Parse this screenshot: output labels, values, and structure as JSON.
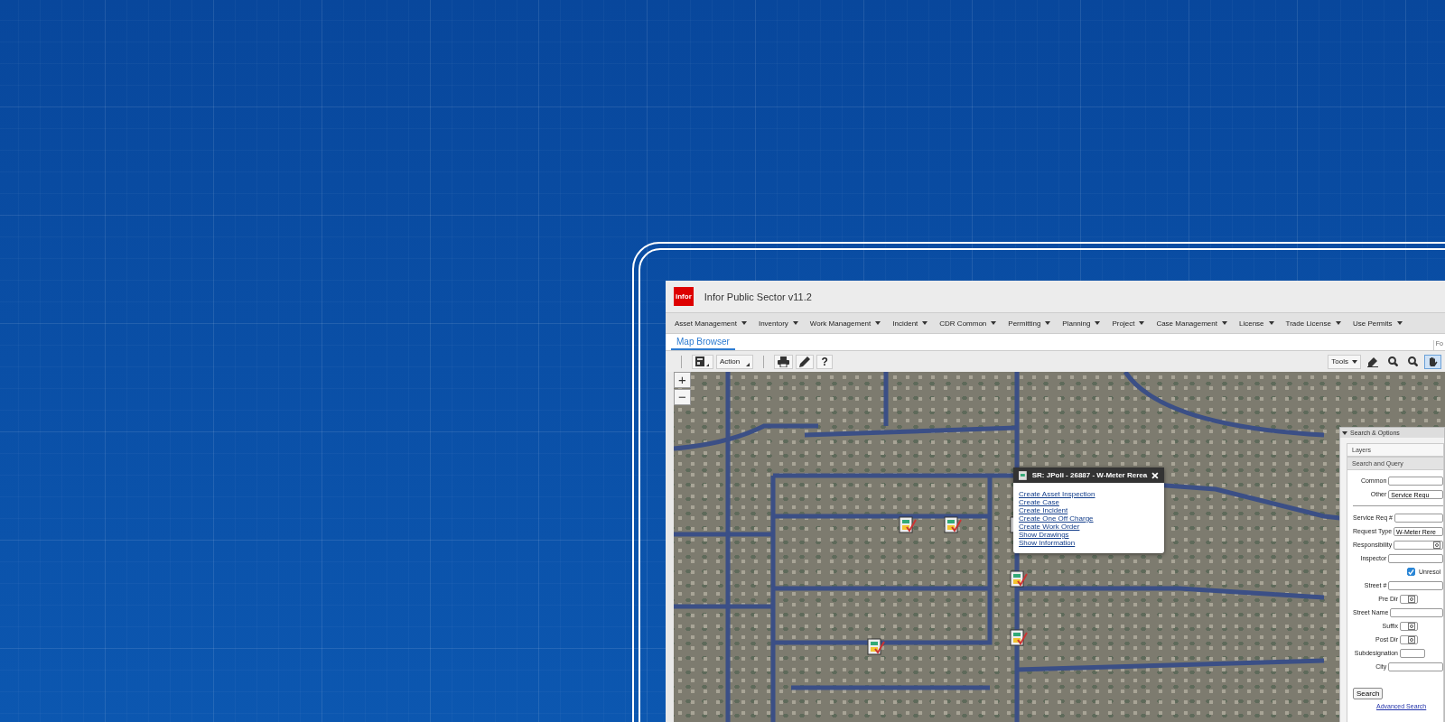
{
  "window": {
    "title": "Infor Public Sector v11.2",
    "logo": "infor"
  },
  "menu": [
    {
      "label": "Asset Management"
    },
    {
      "label": "Inventory"
    },
    {
      "label": "Work Management"
    },
    {
      "label": "Incident"
    },
    {
      "label": "CDR Common"
    },
    {
      "label": "Permitting"
    },
    {
      "label": "Planning"
    },
    {
      "label": "Project"
    },
    {
      "label": "Case Management"
    },
    {
      "label": "License"
    },
    {
      "label": "Trade License"
    },
    {
      "label": "Use Permits"
    }
  ],
  "tabs": [
    {
      "label": "Map Browser",
      "selected": true
    }
  ],
  "tab_bar_text": "Fo",
  "toolbar": {
    "action": "Action",
    "help": "?",
    "tools": "Tools",
    "map_tools": [
      {
        "kind": "eraser",
        "selected": false
      },
      {
        "kind": "zoom-in",
        "selected": false
      },
      {
        "kind": "zoom-out",
        "selected": false
      },
      {
        "kind": "pan",
        "selected": true
      }
    ]
  },
  "map": {
    "zoom_in": "+",
    "zoom_out": "−",
    "popup": {
      "title": "SR: JPoli - 26887 - W-Meter Rerea",
      "links": [
        "Create Asset Inspection",
        "Create Case",
        "Create Incident",
        "Create One Off Charge",
        "Create Work Order",
        "Show Drawings",
        "Show Information"
      ]
    }
  },
  "search_panel": {
    "title": "Search & Options",
    "sections": [
      {
        "label": "Layers",
        "selected": false
      },
      {
        "label": "Search and Query",
        "selected": true
      }
    ],
    "fields": [
      {
        "kind": "text",
        "label": "Common"
      },
      {
        "kind": "select",
        "label": "Other",
        "value": "Service Requ"
      },
      {
        "kind": "divider"
      },
      {
        "kind": "text",
        "label": "Service Req #"
      },
      {
        "kind": "text",
        "label": "Request Type",
        "value": "W-Meter Rere"
      },
      {
        "kind": "lookup",
        "label": "Responsibility"
      },
      {
        "kind": "text",
        "label": "Inspector"
      },
      {
        "kind": "checkbox",
        "label": "Unresol",
        "checked": true
      },
      {
        "kind": "text",
        "label": "Street #"
      },
      {
        "kind": "lookup-small",
        "label": "Pre Dir"
      },
      {
        "kind": "text",
        "label": "Street Name"
      },
      {
        "kind": "lookup-small",
        "label": "Suffix"
      },
      {
        "kind": "lookup-small",
        "label": "Post Dir"
      },
      {
        "kind": "short",
        "label": "Subdesignation"
      },
      {
        "kind": "text",
        "label": "City"
      }
    ],
    "search_button": "Search",
    "advanced_link": "Advanced Search"
  }
}
